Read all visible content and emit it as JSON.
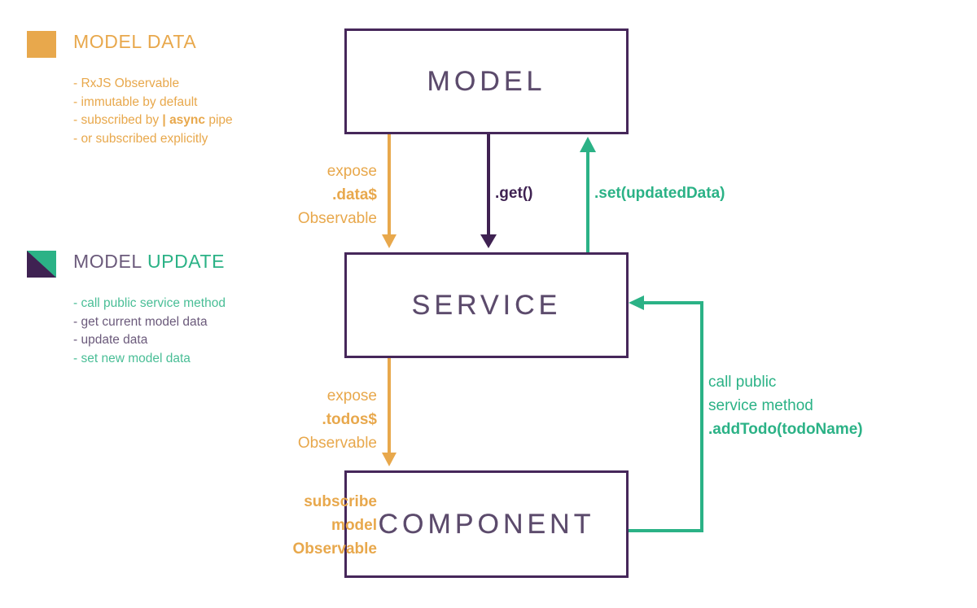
{
  "colors": {
    "orange": "#E8A84C",
    "orange_light": "#EDB466",
    "purple": "#3F2252",
    "purple_border": "#46275A",
    "purple_text": "#6b5a7b",
    "green": "#2BB286",
    "green_light": "#49BE96",
    "background": "#FFFFFF"
  },
  "legend": [
    {
      "key": "model-data",
      "swatch": "solid-orange-square",
      "title_parts": [
        {
          "text": "MODEL DATA",
          "tone": "orange"
        }
      ],
      "items": [
        {
          "prefix": "- ",
          "text": "RxJS Observable",
          "tone": "orange"
        },
        {
          "prefix": "- ",
          "text": "immutable by default",
          "tone": "orange"
        },
        {
          "prefix": "- ",
          "text": "subscribed by ",
          "bold": "| async",
          "suffix": " pipe",
          "tone": "orange"
        },
        {
          "prefix": "- ",
          "text": "or subscribed explicitly",
          "tone": "orange"
        }
      ]
    },
    {
      "key": "model-update",
      "swatch": "diagonal-purple-green-square",
      "title_parts": [
        {
          "text": "MODEL",
          "tone": "purple"
        },
        {
          "text": " UPDATE",
          "tone": "green"
        }
      ],
      "items": [
        {
          "prefix": "- ",
          "text": "call public service method",
          "tone": "green"
        },
        {
          "prefix": "- ",
          "text": "get current model data",
          "tone": "purple"
        },
        {
          "prefix": "- ",
          "text": "update data",
          "tone": "purple"
        },
        {
          "prefix": "- ",
          "text": "set new model data",
          "tone": "green"
        }
      ]
    }
  ],
  "nodes": {
    "model": {
      "label": "MODEL"
    },
    "service": {
      "label": "SERVICE"
    },
    "component": {
      "label": "COMPONENT"
    }
  },
  "edge_labels": {
    "expose_data": {
      "line1": "expose",
      "line2": ".data$",
      "line3": "Observable",
      "tone": "orange"
    },
    "get": {
      "text": ".get()",
      "tone": "purple"
    },
    "set": {
      "text": ".set(updatedData)",
      "tone": "green"
    },
    "expose_todos": {
      "line1": "expose",
      "line2": ".todos$",
      "line3": "Observable",
      "tone": "orange"
    },
    "subscribe": {
      "line1": "subscribe",
      "line2": "model",
      "line3": "Observable",
      "tone": "orange"
    },
    "call_public": {
      "line1": "call public",
      "line2": "service method",
      "line3": ".addTodo(todoName)",
      "tone": "green"
    }
  },
  "connectors": [
    {
      "name": "model-to-service-data",
      "from": "model",
      "to": "service",
      "color": "#E8A84C",
      "direction": "down",
      "label": "expose .data$ Observable"
    },
    {
      "name": "service-to-model-get",
      "from": "service",
      "to": "model",
      "color": "#3F2252",
      "direction": "down",
      "label": ".get()"
    },
    {
      "name": "service-to-model-set",
      "from": "service",
      "to": "model",
      "color": "#2BB286",
      "direction": "up",
      "label": ".set(updatedData)"
    },
    {
      "name": "service-to-component-todos",
      "from": "service",
      "to": "component",
      "color": "#E8A84C",
      "direction": "down",
      "label": "expose .todos$ Observable"
    },
    {
      "name": "component-to-service-addtodo",
      "from": "component",
      "to": "service",
      "color": "#2BB286",
      "direction": "left",
      "label": "call public service method .addTodo(todoName)"
    }
  ]
}
